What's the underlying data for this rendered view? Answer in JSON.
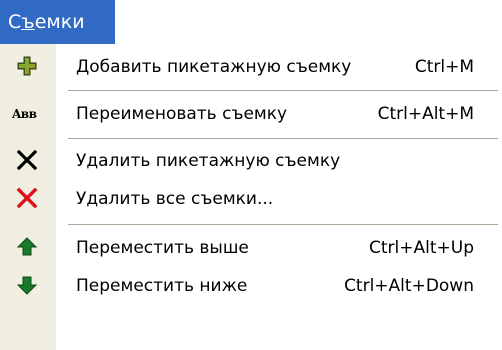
{
  "menu": {
    "title_mnemonic": "С",
    "title_underline": "ъ",
    "title_rest": "емки"
  },
  "items": [
    {
      "label": "Добавить пикетажную съемку",
      "shortcut": "Ctrl+M",
      "icon": "add-plus-icon"
    },
    {
      "label": "Переименовать съемку",
      "shortcut": "Ctrl+Alt+M",
      "icon": "rename-abc-icon",
      "icon_text": "Aвв"
    },
    {
      "label": "Удалить пикетажную съемку",
      "shortcut": "",
      "icon": "delete-black-x-icon"
    },
    {
      "label": "Удалить все съемки...",
      "shortcut": "",
      "icon": "delete-all-red-x-icon"
    },
    {
      "label": "Переместить выше",
      "shortcut": "Ctrl+Alt+Up",
      "icon": "arrow-up-icon"
    },
    {
      "label": "Переместить ниже",
      "shortcut": "Ctrl+Alt+Down",
      "icon": "arrow-down-icon"
    }
  ],
  "colors": {
    "menu_highlight": "#316ac5",
    "icon_column": "#f1efe2",
    "separator": "#aca899",
    "green_icon": "#1a7a2a",
    "red_icon": "#e0101a"
  }
}
